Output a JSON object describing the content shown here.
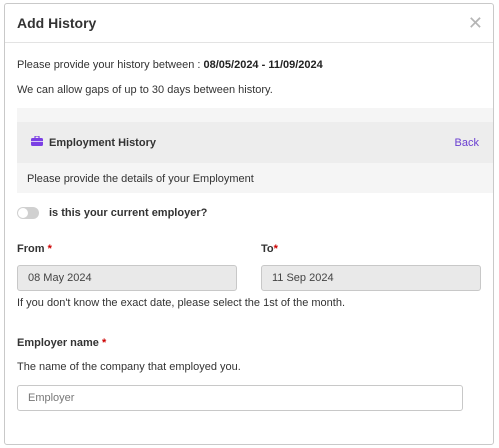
{
  "modal": {
    "title": "Add History",
    "close_symbol": "✕"
  },
  "intro": {
    "history_range_prefix": "Please provide your history between : ",
    "history_range_value": "08/05/2024 - 11/09/2024",
    "gaps_text": "We can allow gaps of up to 30 days between history."
  },
  "panel": {
    "icon": "briefcase-icon",
    "title": "Employment History",
    "back_label": "Back",
    "description": "Please provide the details of your Employment"
  },
  "current_employer": {
    "label": "is this your current employer?",
    "checked": false
  },
  "dates": {
    "from_label": "From",
    "to_label": "To",
    "required_marker": "*",
    "from_value": "08 May 2024",
    "to_value": "11 Sep 2024",
    "hint": "If you don't know the exact date, please select the 1st of the month."
  },
  "employer": {
    "label": "Employer name",
    "required_marker": "*",
    "description": "The name of the company that employed you.",
    "placeholder": "Employer"
  },
  "colors": {
    "accent": "#6a3fd1",
    "required": "#cc0000"
  }
}
